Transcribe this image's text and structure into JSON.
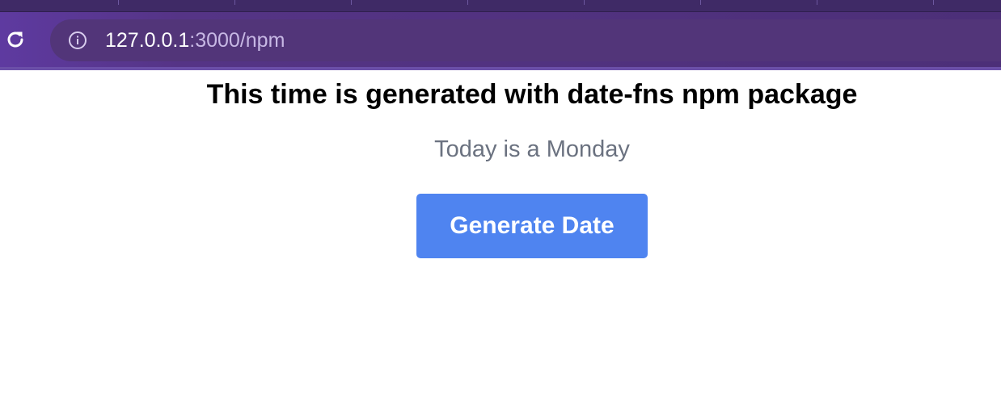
{
  "browser": {
    "url_host": "127.0.0.1",
    "url_rest": ":3000/npm",
    "icons": {
      "reload": "reload-icon",
      "site_info": "info-icon"
    }
  },
  "page": {
    "heading": "This time is generated with date-fns npm package",
    "subtitle": "Today is a Monday",
    "button_label": "Generate Date"
  },
  "colors": {
    "chrome_bg": "#4c2f78",
    "omnibox_bg": "#523579",
    "heading": "#000000",
    "subtitle": "#6b7280",
    "button_bg": "#4f84f0",
    "button_text": "#ffffff"
  }
}
